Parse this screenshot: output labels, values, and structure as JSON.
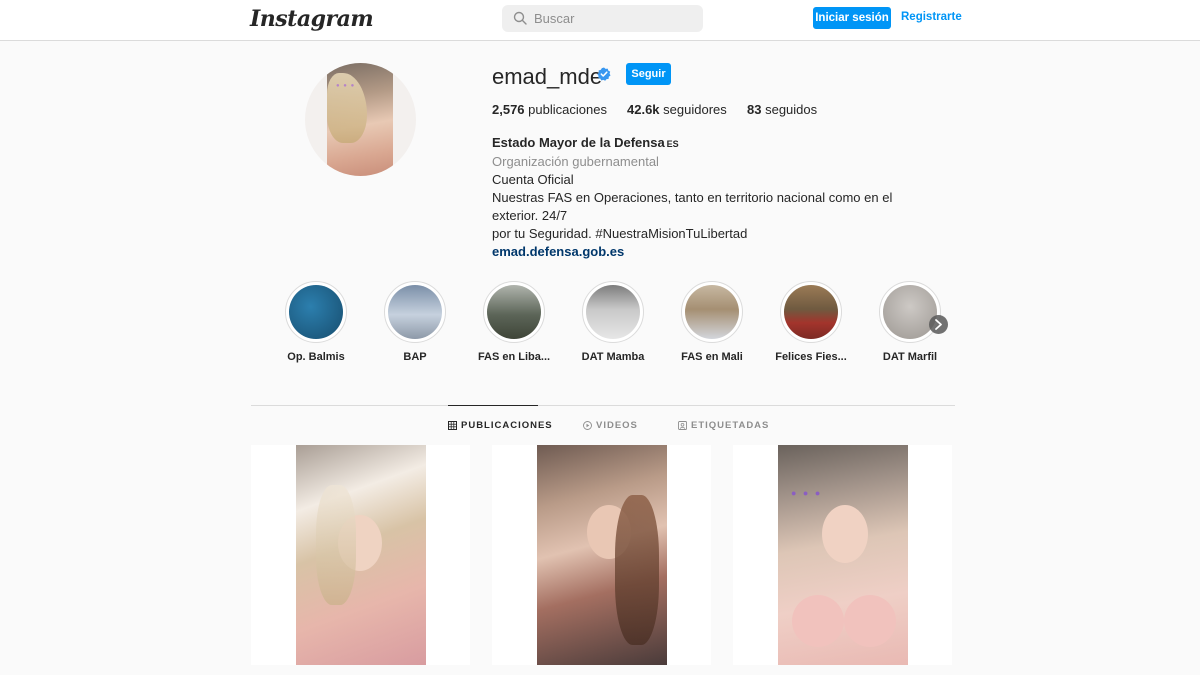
{
  "nav": {
    "logo": "Instagram",
    "search_placeholder": "Buscar",
    "login_label": "Iniciar sesión",
    "signup_label": "Registrarte"
  },
  "profile": {
    "username": "emad_mde",
    "verified": true,
    "follow_label": "Seguir",
    "stats": {
      "posts_value": "2,576",
      "posts_label": "publicaciones",
      "followers_value": "42.6k",
      "followers_label": "seguidores",
      "following_value": "83",
      "following_label": "seguidos"
    },
    "bio": {
      "name": "Estado Mayor de la Defensa",
      "flag": "ES",
      "category": "Organización gubernamental",
      "line1": "Cuenta Oficial",
      "line2": "Nuestras FAS en Operaciones, tanto en territorio nacional como en el exterior. 24/7",
      "line3": "por tu Seguridad. #NuestraMisionTuLibertad",
      "link": "emad.defensa.gob.es"
    }
  },
  "highlights": [
    {
      "label": "Op. Balmis",
      "color": "#1d5f86"
    },
    {
      "label": "BAP",
      "color": "#8ea2b8"
    },
    {
      "label": "FAS en Liba...",
      "color": "#6d7468"
    },
    {
      "label": "DAT Mamba",
      "color": "#a6a6a6"
    },
    {
      "label": "FAS en Mali",
      "color": "#b9a996"
    },
    {
      "label": "Felices Fies...",
      "color": "#7c5b3d"
    },
    {
      "label": "DAT Marfil",
      "color": "#b7b2ad"
    }
  ],
  "tabs": {
    "posts": "PUBLICACIONES",
    "videos": "VIDEOS",
    "tagged": "ETIQUETADAS"
  },
  "colors": {
    "accent": "#0095f6",
    "text": "#262626",
    "muted": "#8e8e8e",
    "border": "#dbdbdb",
    "background": "#fafafa"
  }
}
